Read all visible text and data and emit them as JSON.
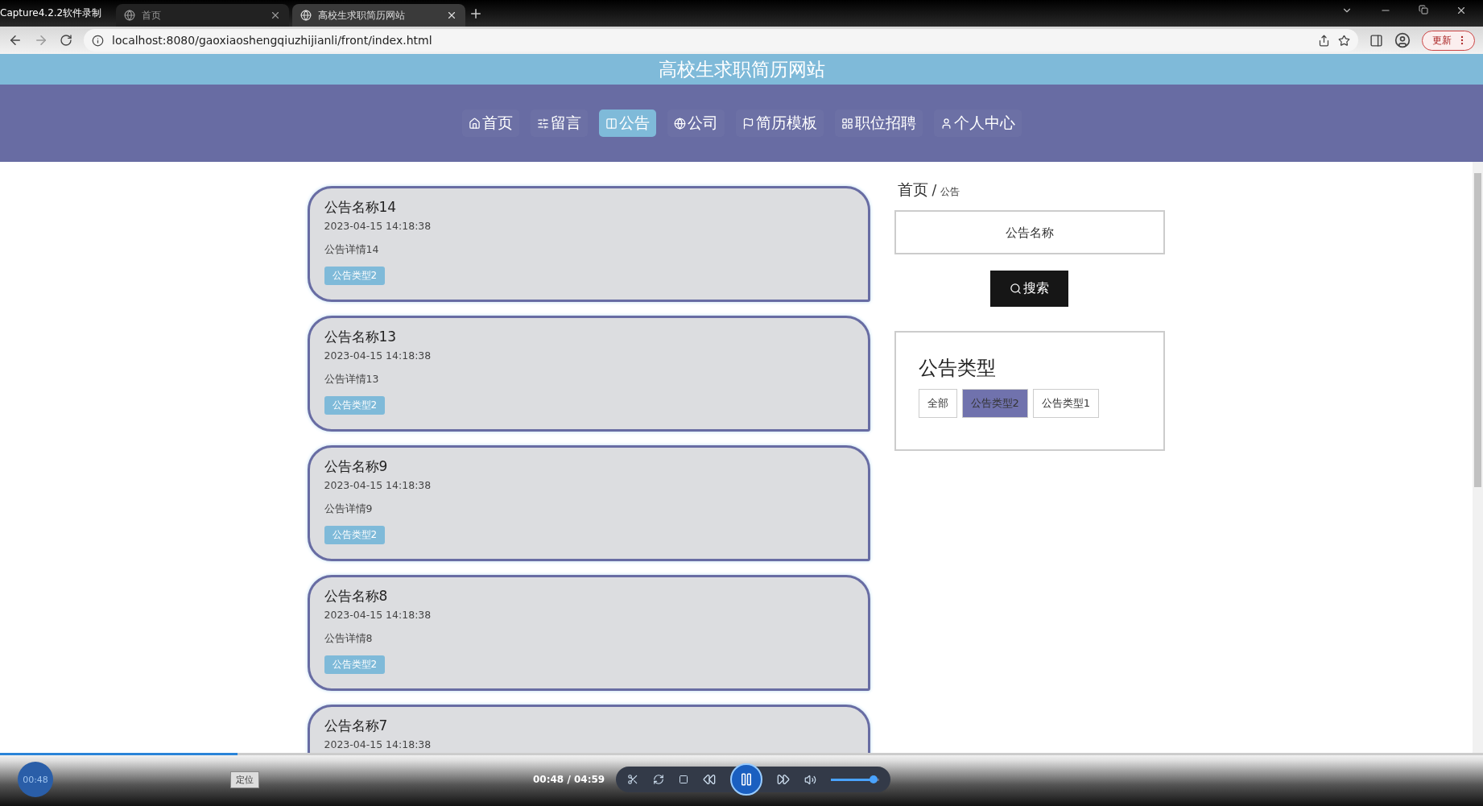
{
  "recorder": {
    "title": "Capture4.2.2软件录制"
  },
  "browser": {
    "tabs": [
      {
        "label": "首页",
        "selected": false
      },
      {
        "label": "高校生求职简历网站",
        "selected": true
      }
    ],
    "url": "localhost:8080/gaoxiaoshengqiuzhijianli/front/index.html",
    "update_button": "更新"
  },
  "site": {
    "title": "高校生求职简历网站",
    "nav": [
      {
        "label": "首页",
        "selected": false
      },
      {
        "label": "留言",
        "selected": false
      },
      {
        "label": "公告",
        "selected": true
      },
      {
        "label": "公司",
        "selected": false
      },
      {
        "label": "简历模板",
        "selected": false
      },
      {
        "label": "职位招聘",
        "selected": false
      },
      {
        "label": "个人中心",
        "selected": false
      }
    ]
  },
  "notices": [
    {
      "title": "公告名称14",
      "date": "2023-04-15 14:18:38",
      "detail": "公告详情14",
      "tag": "公告类型2"
    },
    {
      "title": "公告名称13",
      "date": "2023-04-15 14:18:38",
      "detail": "公告详情13",
      "tag": "公告类型2"
    },
    {
      "title": "公告名称9",
      "date": "2023-04-15 14:18:38",
      "detail": "公告详情9",
      "tag": "公告类型2"
    },
    {
      "title": "公告名称8",
      "date": "2023-04-15 14:18:38",
      "detail": "公告详情8",
      "tag": "公告类型2"
    },
    {
      "title": "公告名称7",
      "date": "2023-04-15 14:18:38"
    }
  ],
  "sidebar": {
    "breadcrumb": {
      "home": "首页",
      "separator": "/",
      "current": "公告"
    },
    "search": {
      "placeholder": "公告名称",
      "button": "搜索"
    },
    "types": {
      "title": "公告类型",
      "items": [
        {
          "label": "全部",
          "selected": false
        },
        {
          "label": "公告类型2",
          "selected": true
        },
        {
          "label": "公告类型1",
          "selected": false
        }
      ]
    }
  },
  "player": {
    "progress": {
      "level": 0.16
    },
    "elapsed_badge": "00:48",
    "locate_button": "定位",
    "time": "00:48 / 04:59",
    "volume": {
      "level": 0.88
    }
  }
}
